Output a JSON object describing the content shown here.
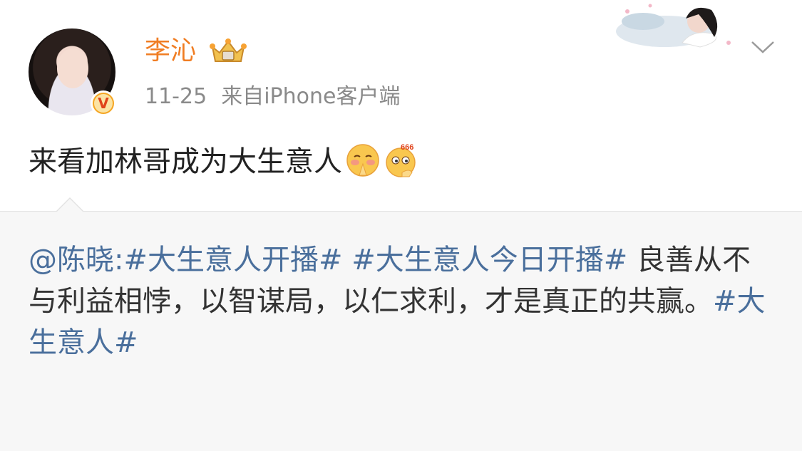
{
  "post": {
    "username": "李沁",
    "date": "11-25",
    "source_prefix": "来自",
    "source": "iPhone客户端",
    "text": "来看加林哥成为大生意人",
    "emojis": [
      "praying-blush-emoji",
      "666-thumbs-emoji"
    ]
  },
  "repost": {
    "mention": "@陈晓",
    "colon": ":",
    "hashtag1": "#大生意人开播#",
    "space1": " ",
    "hashtag2": "#大生意人今日开播#",
    "body": " 良善从不与利益相悖，以智谋局，以仁求利，才是真正的共赢。",
    "hashtag3": "#大生意人#"
  },
  "colors": {
    "username": "#f07d23",
    "link": "#4a6f9c",
    "meta": "#8a8a8a",
    "repost_bg": "#f7f7f7"
  },
  "icons": [
    "crown-icon",
    "verified-badge-icon",
    "chevron-down-icon",
    "header-decoration"
  ]
}
